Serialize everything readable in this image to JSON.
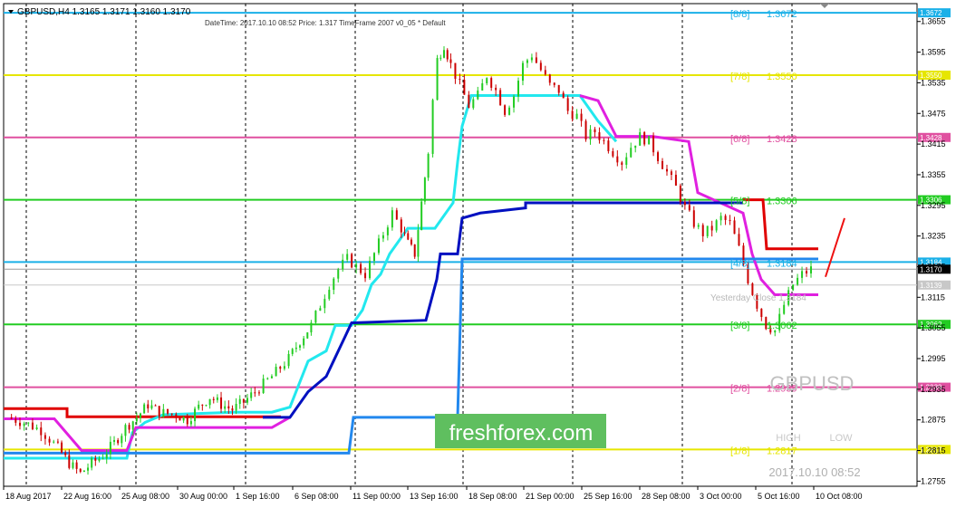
{
  "header": {
    "symbol_info": "GBPUSD,H4  1.3165 1.3171 1.3160 1.3170",
    "info_line": "DateTime: 2017.10.10 08:52    Price: 1.317    TimeFrame 2007  v0_05      *   Default"
  },
  "watermark": {
    "brand": "freshforex.com",
    "symbol": "GBPUSD",
    "high_label": "HIGH",
    "low_label": "LOW",
    "datetime": "2017.10.10 08:52",
    "yesterday_label": "Yesterday Close 1.3184"
  },
  "price_axis": {
    "ticks": [
      "1.3655",
      "1.3595",
      "1.3535",
      "1.3475",
      "1.3415",
      "1.3355",
      "1.3295",
      "1.3235",
      "1.3175",
      "1.3115",
      "1.3055",
      "1.2995",
      "1.2935",
      "1.2875",
      "1.2815",
      "1.2755"
    ],
    "current_price": "1.3170",
    "grey_price": "1.3139"
  },
  "time_axis": {
    "labels": [
      "18 Aug 2017",
      "22 Aug 16:00",
      "25 Aug 08:00",
      "30 Aug 00:00",
      "1 Sep 16:00",
      "6 Sep 08:00",
      "11 Sep 00:00",
      "13 Sep 16:00",
      "18 Sep 08:00",
      "21 Sep 00:00",
      "25 Sep 16:00",
      "28 Sep 08:00",
      "3 Oct 00:00",
      "5 Oct 16:00",
      "10 Oct 08:00"
    ]
  },
  "murrey_levels": [
    {
      "name": "[8/8]",
      "price": "1.3672",
      "color": "#1ab0e8"
    },
    {
      "name": "[7/8]",
      "price": "1.3550",
      "color": "#e6e600"
    },
    {
      "name": "[6/8]",
      "price": "1.3428",
      "color": "#e050a0"
    },
    {
      "name": "[5/8]",
      "price": "1.3306",
      "color": "#22cc22"
    },
    {
      "name": "[4/8]",
      "price": "1.3184",
      "color": "#1ab0e8"
    },
    {
      "name": "[3/8]",
      "price": "1.3062",
      "color": "#22cc22"
    },
    {
      "name": "[2/8]",
      "price": "1.2939",
      "color": "#e050a0"
    },
    {
      "name": "[1/8]",
      "price": "1.2817",
      "color": "#e6e600"
    }
  ],
  "chart_data": {
    "type": "candlestick",
    "symbol": "GBPUSD",
    "timeframe": "H4",
    "ylim": [
      1.2745,
      1.369
    ],
    "last_ohlc": {
      "open": 1.3165,
      "high": 1.3171,
      "low": 1.316,
      "close": 1.317
    },
    "grid": true,
    "levels": [
      1.3672,
      1.355,
      1.3428,
      1.3306,
      1.3184,
      1.3062,
      1.2939,
      1.2817
    ],
    "close_path": [
      [
        0,
        1.288
      ],
      [
        15,
        1.287
      ],
      [
        30,
        1.2855
      ],
      [
        45,
        1.282
      ],
      [
        55,
        1.279
      ],
      [
        65,
        1.277
      ],
      [
        75,
        1.279
      ],
      [
        85,
        1.2805
      ],
      [
        95,
        1.283
      ],
      [
        105,
        1.286
      ],
      [
        115,
        1.288
      ],
      [
        125,
        1.2905
      ],
      [
        135,
        1.289
      ],
      [
        150,
        1.2885
      ],
      [
        160,
        1.2875
      ],
      [
        170,
        1.29
      ],
      [
        180,
        1.292
      ],
      [
        190,
        1.2905
      ],
      [
        200,
        1.2895
      ],
      [
        210,
        1.291
      ],
      [
        220,
        1.293
      ],
      [
        235,
        1.296
      ],
      [
        250,
        1.2995
      ],
      [
        260,
        1.303
      ],
      [
        270,
        1.306
      ],
      [
        278,
        1.31
      ],
      [
        286,
        1.314
      ],
      [
        294,
        1.317
      ],
      [
        302,
        1.319
      ],
      [
        310,
        1.3175
      ],
      [
        318,
        1.316
      ],
      [
        326,
        1.32
      ],
      [
        334,
        1.324
      ],
      [
        342,
        1.328
      ],
      [
        350,
        1.325
      ],
      [
        356,
        1.322
      ],
      [
        362,
        1.32
      ],
      [
        368,
        1.33
      ],
      [
        374,
        1.34
      ],
      [
        378,
        1.35
      ],
      [
        382,
        1.358
      ],
      [
        388,
        1.361
      ],
      [
        394,
        1.357
      ],
      [
        402,
        1.353
      ],
      [
        410,
        1.349
      ],
      [
        418,
        1.351
      ],
      [
        426,
        1.355
      ],
      [
        434,
        1.352
      ],
      [
        442,
        1.348
      ],
      [
        450,
        1.351
      ],
      [
        458,
        1.357
      ],
      [
        466,
        1.359
      ],
      [
        474,
        1.356
      ],
      [
        482,
        1.353
      ],
      [
        490,
        1.352
      ],
      [
        498,
        1.348
      ],
      [
        506,
        1.347
      ],
      [
        514,
        1.343
      ],
      [
        522,
        1.344
      ],
      [
        530,
        1.342
      ],
      [
        538,
        1.34
      ],
      [
        546,
        1.338
      ],
      [
        554,
        1.341
      ],
      [
        562,
        1.343
      ],
      [
        570,
        1.342
      ],
      [
        578,
        1.339
      ],
      [
        586,
        1.336
      ],
      [
        594,
        1.333
      ],
      [
        602,
        1.329
      ],
      [
        610,
        1.326
      ],
      [
        618,
        1.324
      ],
      [
        626,
        1.325
      ],
      [
        634,
        1.327
      ],
      [
        642,
        1.326
      ],
      [
        650,
        1.321
      ],
      [
        658,
        1.315
      ],
      [
        666,
        1.31
      ],
      [
        674,
        1.306
      ],
      [
        682,
        1.305
      ],
      [
        690,
        1.31
      ],
      [
        698,
        1.314
      ],
      [
        706,
        1.316
      ],
      [
        714,
        1.317
      ]
    ]
  }
}
